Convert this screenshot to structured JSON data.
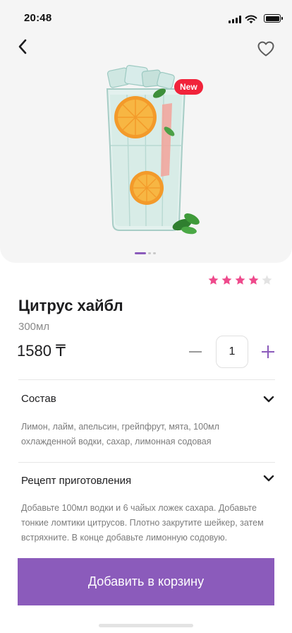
{
  "status_bar": {
    "time": "20:48",
    "icons": [
      "signal-icon",
      "wifi-icon",
      "battery-icon"
    ]
  },
  "header": {
    "back_icon": "chevron-left-icon",
    "favorite_icon": "heart-outline-icon"
  },
  "product": {
    "badge": "New",
    "name": "Цитрус хайбл",
    "volume": "300мл",
    "price": "1580 ₸",
    "image": "citrus-highball-glass",
    "gallery": {
      "pages": 3,
      "current": 1
    },
    "rating": {
      "value": 4,
      "max": 5
    }
  },
  "quantity": {
    "value": "1"
  },
  "sections": [
    {
      "title": "Состав",
      "text": "Лимон, лайм, апельсин, грейпфрут, мята, 100мл охлажденной водки, сахар, лимонная содовая"
    },
    {
      "title": "Рецепт приготовления",
      "text": "Добавьте 100мл  водки и 6 чайых ложек сахара. Добавьте тонкие ломтики цитрусов. Плотно закрутите шейкер, затем встряхните. В конце добавьте лимонную содовую."
    }
  ],
  "cart_button": {
    "label": "Добавить в корзину"
  },
  "colors": {
    "accent": "#8b5bbb",
    "badge": "#f1233a",
    "star_active": "#ee4a8c",
    "star_inactive": "#e3e3e3",
    "muted_text": "#7c7c7c"
  }
}
